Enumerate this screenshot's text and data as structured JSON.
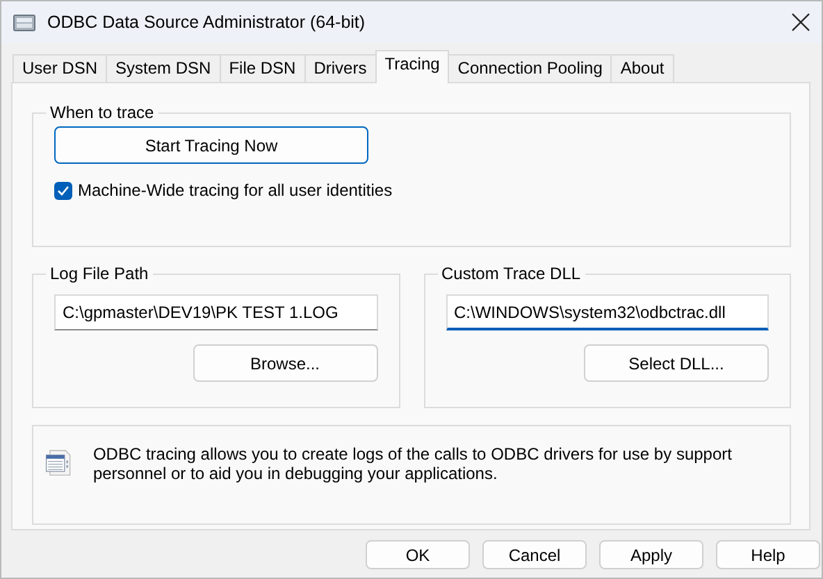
{
  "window": {
    "title": "ODBC Data Source Administrator (64-bit)"
  },
  "tabs": [
    {
      "label": "User DSN",
      "selected": false
    },
    {
      "label": "System DSN",
      "selected": false
    },
    {
      "label": "File DSN",
      "selected": false
    },
    {
      "label": "Drivers",
      "selected": false
    },
    {
      "label": "Tracing",
      "selected": true
    },
    {
      "label": "Connection Pooling",
      "selected": false
    },
    {
      "label": "About",
      "selected": false
    }
  ],
  "when_to_trace": {
    "title": "When to trace",
    "start_button": "Start Tracing Now",
    "machine_wide": {
      "label": "Machine-Wide tracing for all user identities",
      "checked": true
    }
  },
  "log_file_path": {
    "title": "Log File Path",
    "value": "C:\\gpmaster\\DEV19\\PK TEST 1.LOG",
    "focused": false,
    "button": "Browse..."
  },
  "custom_trace_dll": {
    "title": "Custom Trace DLL",
    "value": "C:\\WINDOWS\\system32\\odbctrac.dll",
    "focused": true,
    "button": "Select DLL..."
  },
  "info": {
    "text": "ODBC tracing allows you to create logs of the calls to ODBC drivers for use by support personnel or to aid you in debugging your applications."
  },
  "buttons": [
    "OK",
    "Cancel",
    "Apply",
    "Help"
  ]
}
